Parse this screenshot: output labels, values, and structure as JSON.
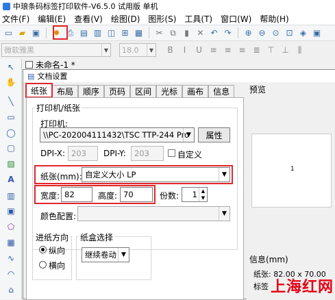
{
  "app": {
    "title": "中琅条码标签打印软件-V6.5.0 试用版 单机"
  },
  "menu": [
    "文件(F)",
    "编辑(E)",
    "查看(V)",
    "绘图(D)",
    "图形(S)",
    "工具(T)",
    "窗口(W)",
    "帮助(H)"
  ],
  "toolbar2": {
    "font_placeholder": "微软雅黑",
    "size_placeholder": "18.0"
  },
  "document_tab": {
    "title": "未命名-1 *"
  },
  "dialog": {
    "title": "文档设置",
    "tabs": [
      "纸张",
      "布局",
      "顺序",
      "页码",
      "区间",
      "光标",
      "画布",
      "信息"
    ],
    "printer_group": "打印机/纸张",
    "printer_label": "打印机:",
    "printer_value": "\\\\PC-202004111432\\TSC TTP-244 Pro",
    "properties_button": "属性",
    "dpi_x_label": "DPI-X:",
    "dpi_x_value": "203",
    "dpi_y_label": "DPI-Y:",
    "dpi_y_value": "203",
    "custom_label": "自定义",
    "paper_label": "纸张(mm):",
    "paper_value": "自定义大小 LP",
    "width_label": "宽度:",
    "width_value": "82",
    "height_label": "高度:",
    "height_value": "70",
    "copies_label": "份数:",
    "copies_value": "1",
    "color_label": "颜色配置:",
    "feed_group": "进纸方向",
    "portrait_label": "纵向",
    "landscape_label": "横向",
    "tray_group": "纸盒选择",
    "tray_value": "继续卷动",
    "preview_label": "预览",
    "preview_page": "1",
    "info_label": "信息(mm)",
    "info_paper": "纸张: 82.00 x 70.00",
    "info_label_row": "标签"
  },
  "watermark": "上海红网",
  "colors": {
    "highlight": "#e0262b",
    "accent": "#2e5aa8"
  }
}
